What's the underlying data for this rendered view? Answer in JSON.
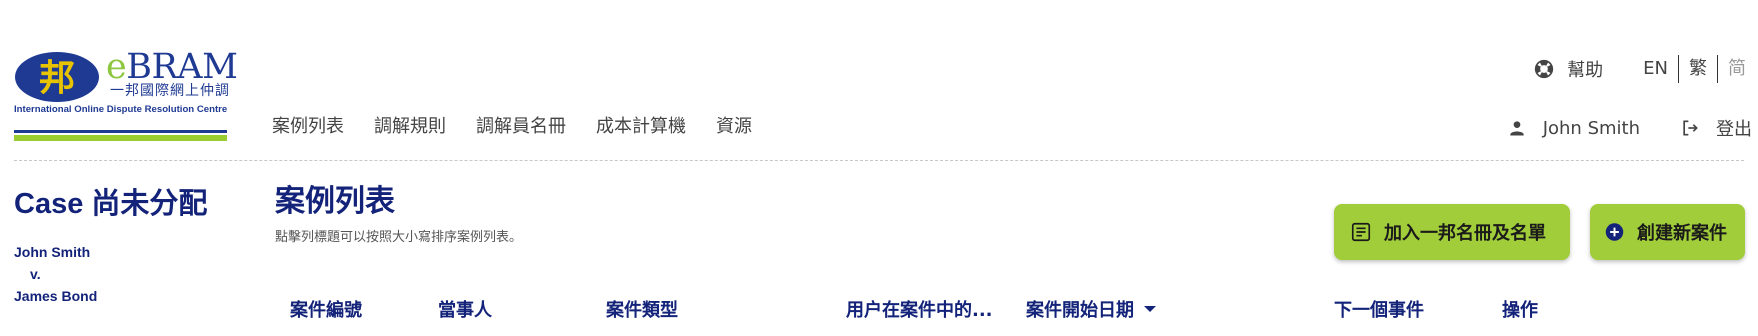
{
  "logo": {
    "mark": "邦",
    "brand_e": "e",
    "brand_rest": "BRAM",
    "cn": "一邦國際網上仲調",
    "en": "International Online Dispute Resolution Centre"
  },
  "nav": [
    "案例列表",
    "調解規則",
    "調解員名冊",
    "成本計算機",
    "資源"
  ],
  "utility": {
    "help": "幫助",
    "languages": [
      "EN",
      "繁",
      "简"
    ]
  },
  "user": {
    "name": "John Smith",
    "logout": "登出"
  },
  "case_panel": {
    "heading": "Case 尚未分配",
    "party_a": "John Smith",
    "versus": "v.",
    "party_b": "James Bond"
  },
  "main": {
    "title": "案例列表",
    "subtitle": "點擊列標題可以按照大小寫排序案例列表。",
    "buttons": {
      "add_to_registry": "加入一邦名冊及名單",
      "create_case": "創建新案件"
    },
    "columns": [
      "案件編號",
      "當事人",
      "案件類型",
      "用户在案件中的...",
      "案件開始日期",
      "下一個事件",
      "操作"
    ]
  },
  "colors": {
    "primary_navy": "#14237a",
    "accent_green": "#a1cd3a"
  },
  "icons": {
    "help": "lifebuoy-icon",
    "user": "person-icon",
    "logout": "logout-icon",
    "add": "registry-list-icon",
    "create": "plus-circle-icon",
    "sort": "sort-down-icon"
  }
}
